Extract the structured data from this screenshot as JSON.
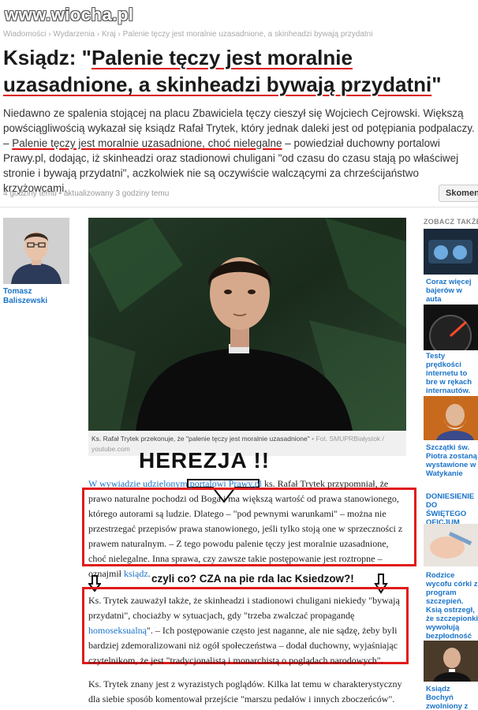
{
  "watermark": "www.wiocha.pl",
  "breadcrumb": "Wiadomości › Wydarzenia › Kraj › Palenie tęczy jest moralnie uzasadnione, a skinheadzi bywają przydatni",
  "article": {
    "title_prefix": "Ksiądz: \"",
    "title_underlined": "Palenie tęczy jest moralnie uzasadnione, a skinheadzi bywają przydatni",
    "title_suffix": "\"",
    "lead_part1": "Niedawno ze spalenia stojącej na placu Zbawiciela tęczy cieszył się Wojciech Cejrowski. Większą powściągliwością wykazał się ksiądz Rafał Trytek, który jednak daleki jest od potępiania podpalaczy. –",
    "lead_underlined": "Palenie tęczy jest moralnie uzasadnione, choć nielegalne",
    "lead_part2": " – powiedział duchowny portalowi Prawy.pl, dodając, iż skinheadzi oraz stadionowi chuligani \"od czasu do czasu stają po właściwej stronie i bywają przydatni\", aczkolwiek nie są oczywiście walczącymi za chrześcijaństwo krzyżowcami.",
    "meta": "4 godziny temu • aktualizowany 3 godziny temu",
    "comments_label": "Skomentuj",
    "author_name": "Tomasz Baliszewski",
    "caption": "Ks. Rafał Trytek przekonuje, że \"palenie tęczy jest moralnie uzasadnione\"",
    "caption_source": " • Fot. SMUPRBiałystok / youtube.com",
    "p1_link": "W wywiadzie udzielonym portalowi Prawy.pl",
    "p1_text": " ks. Rafał Trytek przypomniał, że prawo naturalne pochodzi od Boga i ma większą wartość od prawa stanowionego, którego autorami są ludzie. Dlatego – \"pod pewnymi warunkami\" – można nie przestrzegać przepisów prawa stanowionego, jeśli tylko stoją one w sprzeczności z prawem naturalnym. – Z tego powodu palenie tęczy jest moralnie uzasadnione, choć nielegalne. Inna sprawa, czy zawsze takie postępowanie jest roztropne – oznajmił ",
    "p1_link2": "ksiądz",
    "p1_end": ".",
    "p2_text1": "Ks. Trytek zauważył także, że skinheadzi i stadionowi chuligani niekiedy \"bywają przydatni\", chociażby w sytuacjach, gdy \"trzeba zwalczać propagandę ",
    "p2_link": "homoseksualną",
    "p2_text2": "\". – Ich postępowanie często jest naganne, ale nie sądzę, żeby byli bardziej zdemoralizowani niż ogół społeczeństwa – dodał duchowny, wyjaśniając czytelnikom, że jest \"tradycjonalistą i monarchistą o poglądach narodowych\".",
    "p3_text": "Ks. Trytek znany jest z wyrazistych poglądów. Kilka lat temu w charakterystyczny dla siebie sposób komentował przejście \"marszu pedałów i innych zboczeńców\"."
  },
  "annotations": {
    "herezja": "HEREZJA !!",
    "czyli": "czyli co?  CZA na pie rda lac  Ksiedzow?!",
    "red_color": "#e01b1b"
  },
  "sidebar": {
    "heading": "ZOBACZ TAKŻE:",
    "items": [
      {
        "label": "Coraz więcej bajerów w auta"
      },
      {
        "label": "Testy prędkości internetu to bre w rękach internautów."
      },
      {
        "label": "Szczątki św. Piotra zostaną wystawione w Watykanie"
      },
      {
        "label": "DONIESIENIE DO ŚWIĘTEGO OFICJUM"
      },
      {
        "label": "Rodzice wycofu córki z program szczepień. Ksią ostrzegł, że szczepionki wywołują bezpłodność"
      },
      {
        "label": "Ksiądz Bochyń zwolniony z funkcji rektora"
      }
    ]
  }
}
